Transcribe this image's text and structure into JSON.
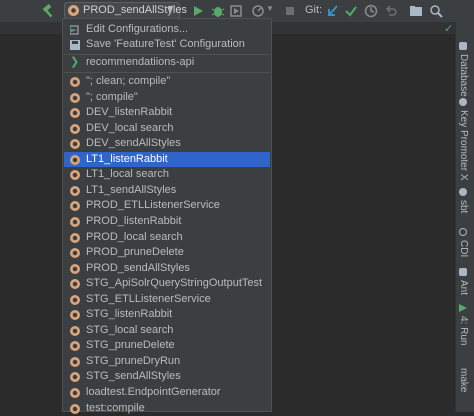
{
  "toolbar": {
    "run_config_label": "PROD_sendAllStyles",
    "git_label": "Git:"
  },
  "menu": {
    "edit_configurations": "Edit Configurations...",
    "save_configuration": "Save 'FeatureTest' Configuration",
    "project": "recommendatiions-api",
    "items": [
      "\"; clean; compile\"",
      "\"; compile\"",
      "DEV_listenRabbit",
      "DEV_local search",
      "DEV_sendAllStyles",
      "LT1_listenRabbit",
      "LT1_local search",
      "LT1_sendAllStyles",
      "PROD_ETLListenerService",
      "PROD_listenRabbit",
      "PROD_local search",
      "PROD_pruneDelete",
      "PROD_sendAllStyles",
      "STG_ApiSolrQueryStringOutputTest",
      "STG_ETLListenerService",
      "STG_listenRabbit",
      "STG_local search",
      "STG_pruneDelete",
      "STG_pruneDryRun",
      "STG_sendAllStyles",
      "loadtest.EndpointGenerator",
      "test:compile"
    ],
    "selected": "LT1_listenRabbit"
  },
  "right_tabs": {
    "database": "Database",
    "key_promoter": "Key Promoter X",
    "sbt": "sbt",
    "cdi": "CDI",
    "ant": "Ant",
    "run": "4: Run",
    "make": "make"
  },
  "colors": {
    "selection": "#2f65ca",
    "popup_bg": "#3c3f41",
    "run_green": "#59a869",
    "git_blue": "#3592c4"
  }
}
